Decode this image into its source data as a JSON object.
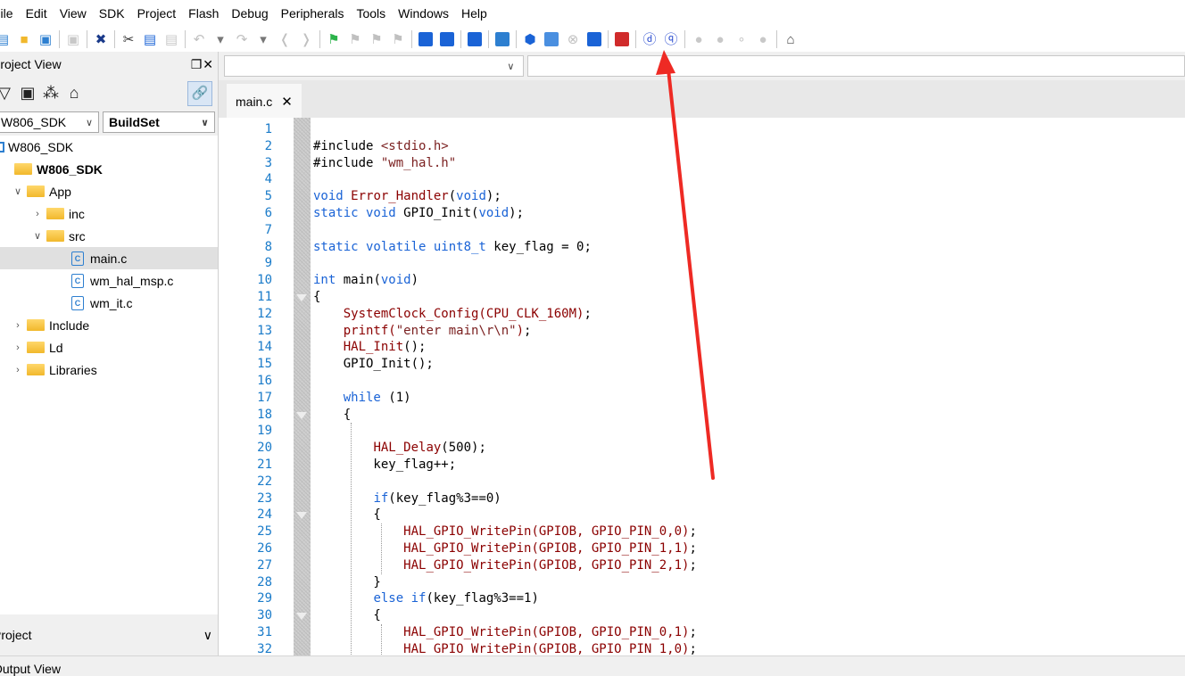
{
  "menu": [
    "File",
    "Edit",
    "View",
    "SDK",
    "Project",
    "Flash",
    "Debug",
    "Peripherals",
    "Tools",
    "Windows",
    "Help"
  ],
  "toolbar_icons": [
    "new-file-icon",
    "open-folder-icon",
    "save-icon",
    "save-all-icon",
    "delete-icon",
    "cut-icon",
    "copy-icon",
    "paste-icon",
    "undo-icon",
    "undo-dropdown-icon",
    "redo-icon",
    "redo-dropdown-icon",
    "back-icon",
    "forward-icon",
    "bookmark-icon",
    "bookmark-prev-icon",
    "bookmark-next-icon",
    "bookmark-clear-icon",
    "find-icon",
    "find-in-files-icon",
    "find-ref-icon",
    "build-config-icon",
    "build-icon",
    "download-icon",
    "stop-icon",
    "clean-icon",
    "load-icon",
    "debug-start-icon",
    "debug-icon",
    "breakpoint-icon",
    "breakpoint-disable-icon",
    "breakpoint-enable-icon",
    "breakpoint-clear-icon",
    "home-icon"
  ],
  "project_view": {
    "title": "Project View",
    "controls": "❐✕",
    "project_select": "W806_SDK",
    "buildset_select": "BuildSet",
    "tree": [
      {
        "label": "W806_SDK",
        "level": 0,
        "kind": "project",
        "twist": ""
      },
      {
        "label": "W806_SDK",
        "level": 1,
        "kind": "folder",
        "twist": "",
        "bold": true
      },
      {
        "label": "App",
        "level": 2,
        "kind": "folder",
        "twist": "∨"
      },
      {
        "label": "inc",
        "level": 3,
        "kind": "folder",
        "twist": "›"
      },
      {
        "label": "src",
        "level": 3,
        "kind": "folder",
        "twist": "∨"
      },
      {
        "label": "main.c",
        "level": 4,
        "kind": "cfile",
        "twist": "",
        "selected": true
      },
      {
        "label": "wm_hal_msp.c",
        "level": 4,
        "kind": "cfile",
        "twist": ""
      },
      {
        "label": "wm_it.c",
        "level": 4,
        "kind": "cfile",
        "twist": ""
      },
      {
        "label": "Include",
        "level": 2,
        "kind": "folder",
        "twist": "›"
      },
      {
        "label": "Ld",
        "level": 2,
        "kind": "folder",
        "twist": "›"
      },
      {
        "label": "Libraries",
        "level": 2,
        "kind": "folder",
        "twist": "›"
      }
    ],
    "bottom_label": "Project"
  },
  "editor": {
    "tab": "main.c",
    "close": "✕",
    "lines": [
      [],
      [
        [
          "pp",
          "#include "
        ],
        [
          "st",
          "<stdio.h>"
        ]
      ],
      [
        [
          "pp",
          "#include "
        ],
        [
          "st",
          "\"wm_hal.h\""
        ]
      ],
      [],
      [
        [
          "kw",
          "void"
        ],
        [
          "t",
          " "
        ],
        [
          "fn",
          "Error_Handler"
        ],
        [
          "t",
          "("
        ],
        [
          "kw",
          "void"
        ],
        [
          "t",
          ");"
        ]
      ],
      [
        [
          "kw",
          "static void"
        ],
        [
          "t",
          " GPIO_Init("
        ],
        [
          "kw",
          "void"
        ],
        [
          "t",
          ");"
        ]
      ],
      [],
      [
        [
          "kw",
          "static volatile uint8_t"
        ],
        [
          "t",
          " key_flag = 0;"
        ]
      ],
      [],
      [
        [
          "kw",
          "int"
        ],
        [
          "t",
          " main("
        ],
        [
          "kw",
          "void"
        ],
        [
          "t",
          ")"
        ]
      ],
      [
        [
          "t",
          "{"
        ]
      ],
      [
        [
          "t",
          "    "
        ],
        [
          "fn",
          "SystemClock_Config(CPU_CLK_160M)"
        ],
        [
          "t",
          ";"
        ]
      ],
      [
        [
          "t",
          "    "
        ],
        [
          "fn",
          "printf("
        ],
        [
          "st",
          "\"enter main\\r\\n\""
        ],
        [
          "fn",
          ")"
        ],
        [
          "t",
          ";"
        ]
      ],
      [
        [
          "t",
          "    "
        ],
        [
          "fn",
          "HAL_Init"
        ],
        [
          "t",
          "();"
        ]
      ],
      [
        [
          "t",
          "    GPIO_Init();"
        ]
      ],
      [],
      [
        [
          "t",
          "    "
        ],
        [
          "kw",
          "while"
        ],
        [
          "t",
          " (1)"
        ]
      ],
      [
        [
          "t",
          "    {"
        ]
      ],
      [],
      [
        [
          "t",
          "        "
        ],
        [
          "fn",
          "HAL_Delay"
        ],
        [
          "t",
          "(500);"
        ]
      ],
      [
        [
          "t",
          "        key_flag++;"
        ]
      ],
      [],
      [
        [
          "t",
          "        "
        ],
        [
          "kw",
          "if"
        ],
        [
          "t",
          "(key_flag%3==0)"
        ]
      ],
      [
        [
          "t",
          "        {"
        ]
      ],
      [
        [
          "t",
          "            "
        ],
        [
          "fn",
          "HAL_GPIO_WritePin(GPIOB, GPIO_PIN_0,0)"
        ],
        [
          "t",
          ";"
        ]
      ],
      [
        [
          "t",
          "            "
        ],
        [
          "fn",
          "HAL_GPIO_WritePin(GPIOB, GPIO_PIN_1,1)"
        ],
        [
          "t",
          ";"
        ]
      ],
      [
        [
          "t",
          "            "
        ],
        [
          "fn",
          "HAL_GPIO_WritePin(GPIOB, GPIO_PIN_2,1)"
        ],
        [
          "t",
          ";"
        ]
      ],
      [
        [
          "t",
          "        }"
        ]
      ],
      [
        [
          "t",
          "        "
        ],
        [
          "kw",
          "else if"
        ],
        [
          "t",
          "(key_flag%3==1)"
        ]
      ],
      [
        [
          "t",
          "        {"
        ]
      ],
      [
        [
          "t",
          "            "
        ],
        [
          "fn",
          "HAL_GPIO_WritePin(GPIOB, GPIO_PIN_0,1)"
        ],
        [
          "t",
          ";"
        ]
      ],
      [
        [
          "t",
          "            "
        ],
        [
          "fn",
          "HAL_GPIO_WritePin(GPIOB, GPIO_PIN_1,0)"
        ],
        [
          "t",
          ";"
        ]
      ]
    ],
    "fold_lines": [
      11,
      18,
      24,
      30
    ]
  },
  "output_view": {
    "title": "Output View"
  },
  "colors": {
    "keyword": "#1a63d6",
    "function": "#8b0000",
    "string": "#7a1f1f",
    "line_number": "#1a7bc9",
    "arrow": "#ee2a24"
  }
}
